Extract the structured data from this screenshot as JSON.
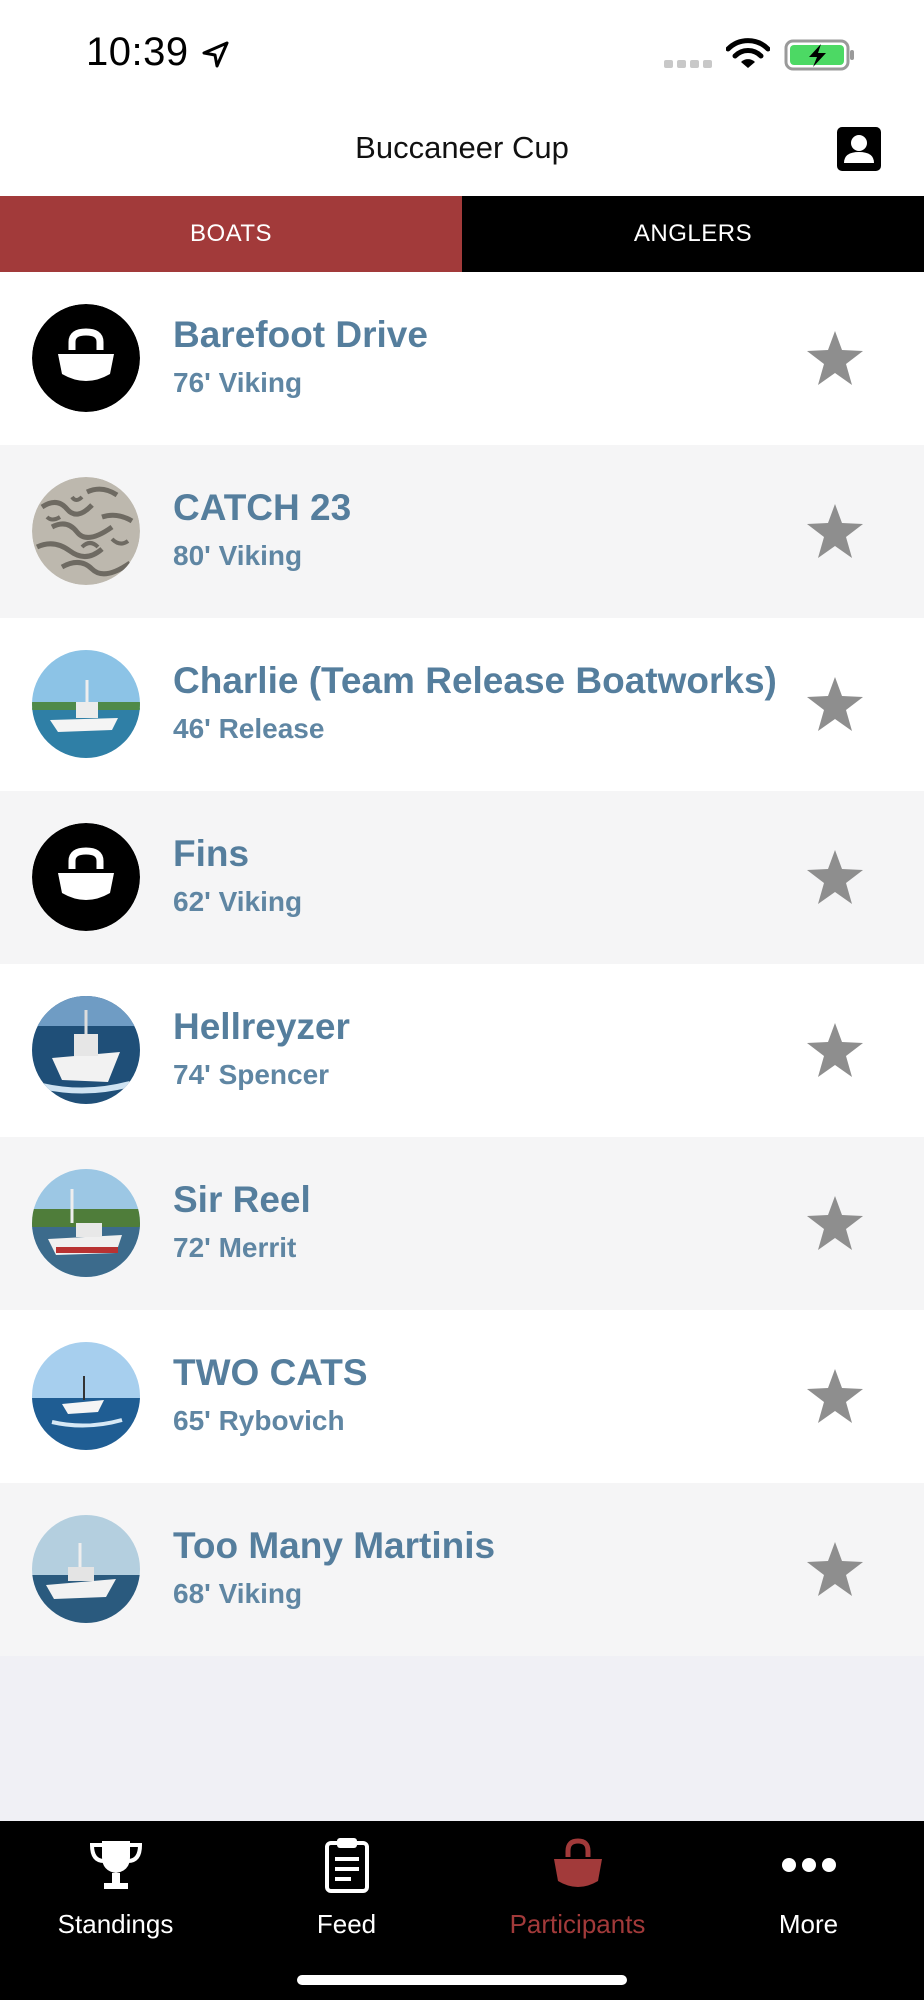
{
  "status_bar": {
    "time": "10:39"
  },
  "header": {
    "title": "Buccaneer Cup"
  },
  "tabs": [
    {
      "label": "BOATS",
      "active": true
    },
    {
      "label": "ANGLERS",
      "active": false
    }
  ],
  "boats": [
    {
      "name": "Barefoot Drive",
      "detail": "76' Viking",
      "avatar": "boat-logo"
    },
    {
      "name": "CATCH 23",
      "detail": "80' Viking",
      "avatar": "pattern-photo"
    },
    {
      "name": "Charlie (Team Release Boatworks)",
      "detail": "46' Release",
      "avatar": "boat-photo"
    },
    {
      "name": "Fins",
      "detail": "62' Viking",
      "avatar": "boat-logo"
    },
    {
      "name": "Hellreyzer",
      "detail": "74' Spencer",
      "avatar": "boat-photo"
    },
    {
      "name": "Sir Reel",
      "detail": "72' Merrit",
      "avatar": "boat-photo"
    },
    {
      "name": "TWO CATS",
      "detail": "65' Rybovich",
      "avatar": "boat-photo"
    },
    {
      "name": "Too Many Martinis",
      "detail": "68' Viking",
      "avatar": "boat-photo"
    }
  ],
  "bottom_nav": [
    {
      "label": "Standings",
      "icon": "trophy-icon",
      "active": false
    },
    {
      "label": "Feed",
      "icon": "clipboard-icon",
      "active": false
    },
    {
      "label": "Participants",
      "icon": "boat-icon",
      "active": true
    },
    {
      "label": "More",
      "icon": "more-dots-icon",
      "active": false
    }
  ],
  "colors": {
    "accent": "#a23a3a",
    "name_text": "#557e9d",
    "star": "#8e8e8e"
  }
}
